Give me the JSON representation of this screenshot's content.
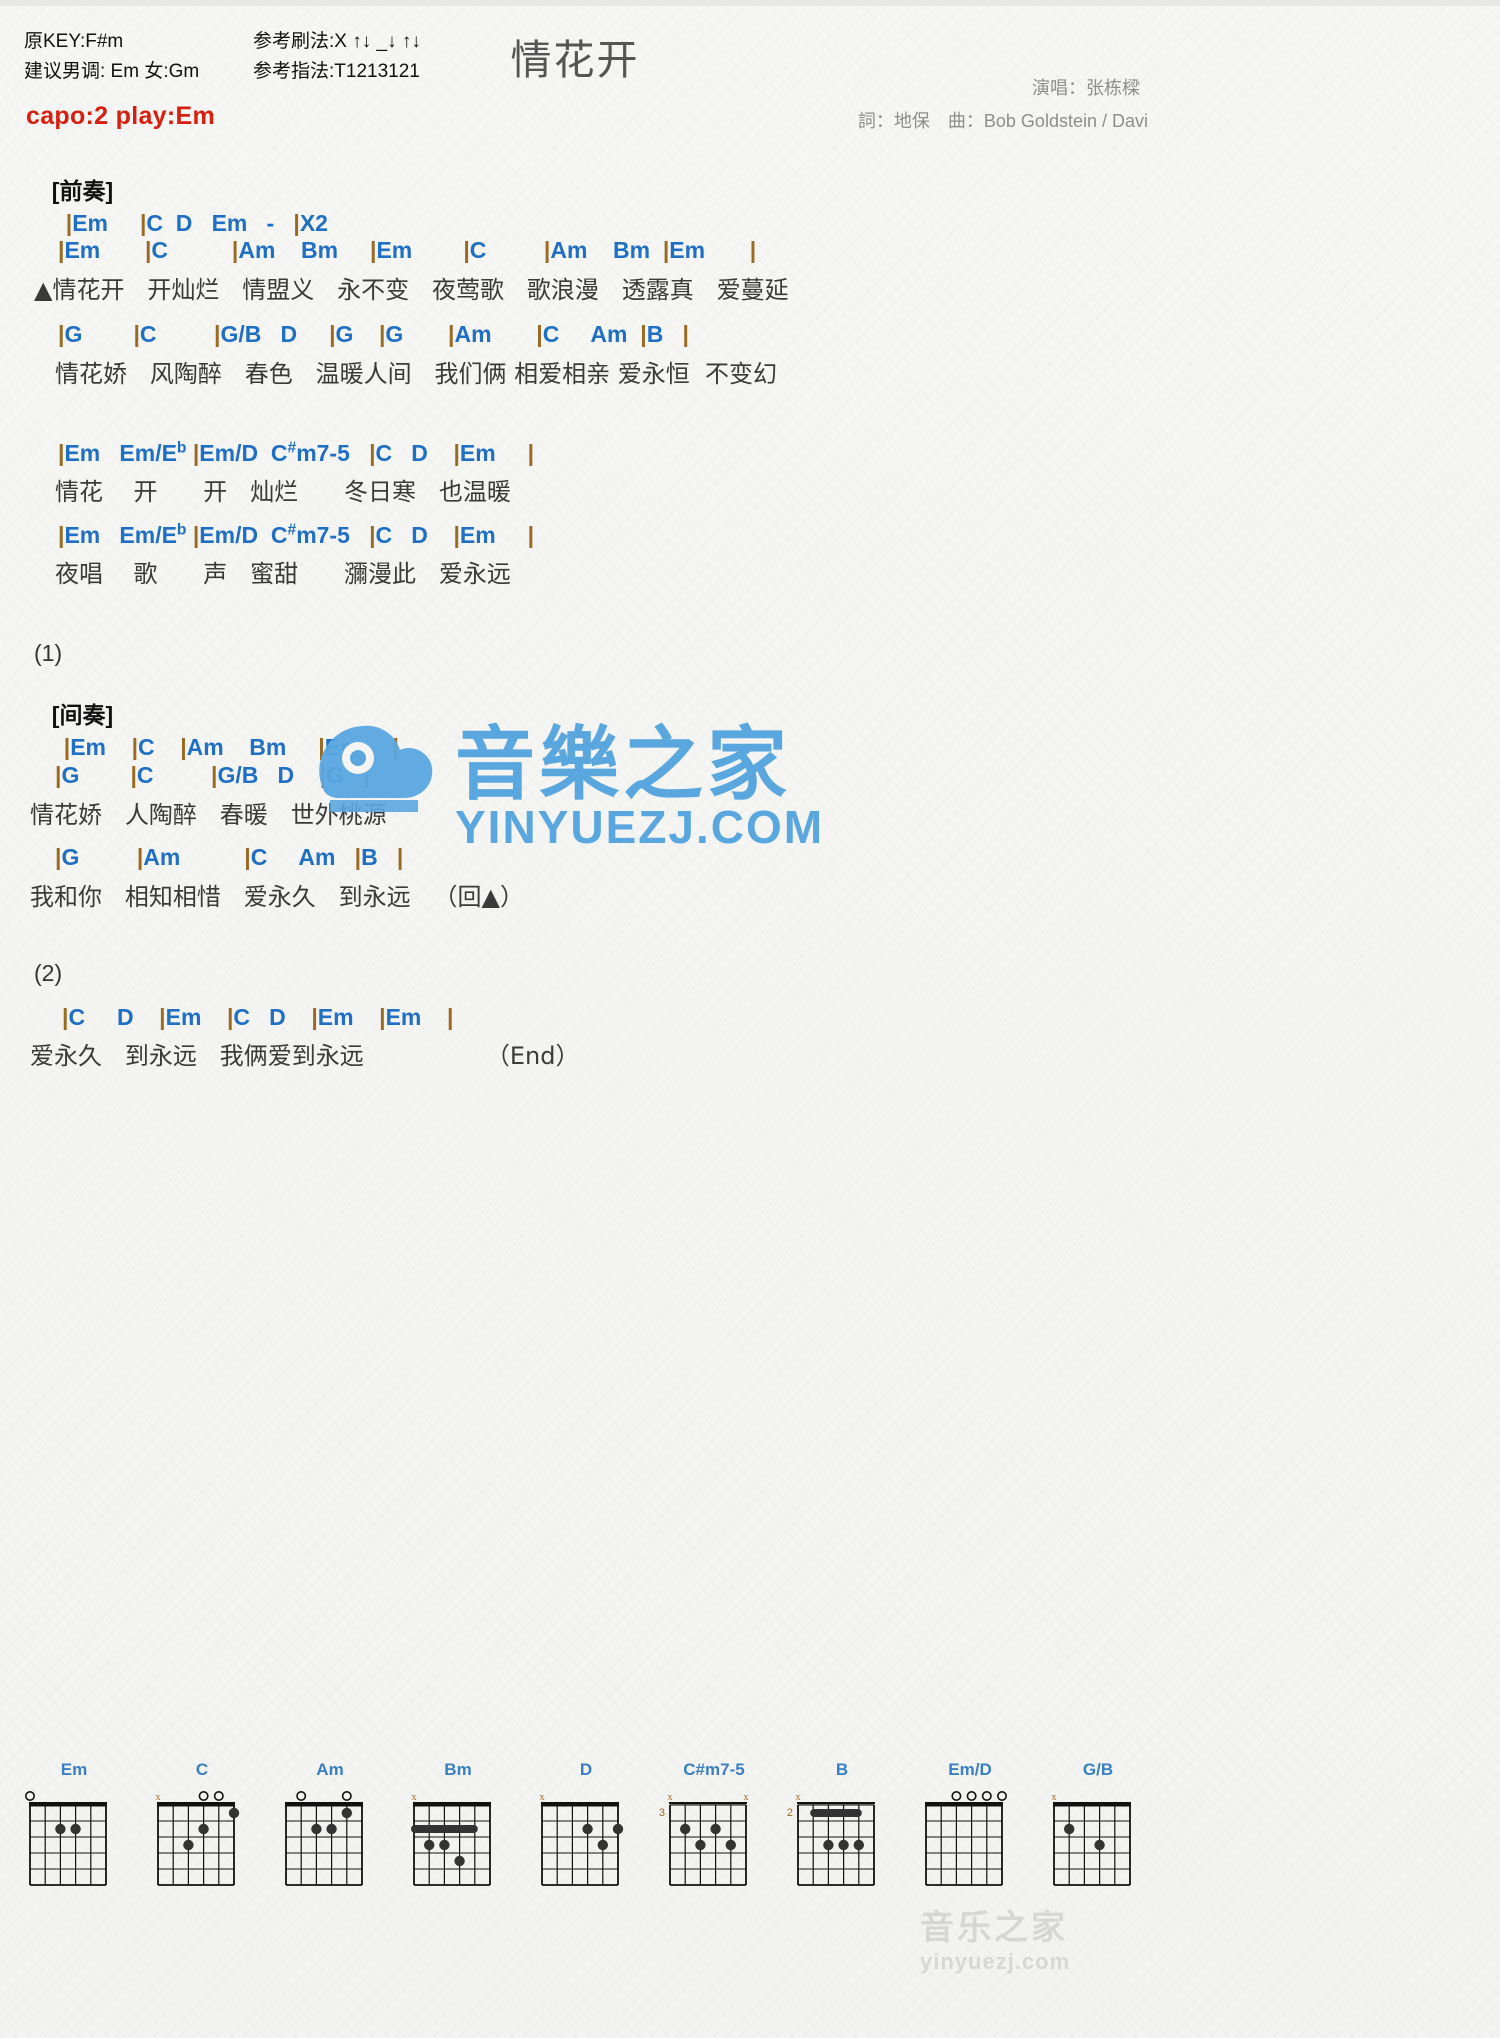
{
  "header": {
    "orig_key": "原KEY:F#m",
    "suggest_key": "建议男调: Em 女:Gm",
    "strum": "参考刷法:X ↑↓ _↓ ↑↓",
    "fingering": "参考指法:T1213121",
    "capo": "capo:2 play:Em",
    "title": "情花开",
    "singer": "演唱：张栋樑",
    "writers": "詞：地保　曲：Bob Goldstein / Davi",
    "accent_color": "#1f6fc4",
    "capo_color": "#d81f0f"
  },
  "intro": {
    "tag": "[前奏]",
    "chords": "|Em     |C  D   Em   -   |X2"
  },
  "verse1": {
    "line1_chords": "|Em       |C          |Am    Bm     |Em        |C         |Am    Bm  |Em       |",
    "line1_lyrics": "▲情花开   开灿烂   情盟义   永不变   夜莺歌   歌浪漫   透露真   爱蔓延",
    "line2_chords": "|G        |C         |G/B   D     |G    |G       |Am       |C     Am  |B   |",
    "line2_lyrics": "情花娇   风陶醉   春色   温暖人间   我们俩 相爱相亲 爱永恒  不变幻"
  },
  "verse2": {
    "line1_chords_parts": [
      "|Em",
      "Em/E",
      "b",
      "|Em/D",
      "C",
      "#",
      "m7-5",
      "|C    D",
      "|Em",
      "|"
    ],
    "line1_lyrics": "情花    开      开   灿烂      冬日寒   也温暖",
    "line2_lyrics": "夜唱    歌      声   蜜甜      瀰漫此   爱永远"
  },
  "section1": {
    "number": "(1)",
    "tag": "[间奏]",
    "chords": "|Em    |C    |Am    Bm     |Em     |",
    "line2_chords": "|G        |C         |G/B   D    |G   |",
    "line2_lyrics": "情花娇   人陶醉   春暖   世外桃源",
    "line3_chords": "|G         |Am          |C     Am   |B   |",
    "line3_lyrics": "我和你   相知相惜   爱永久   到永远   （回▲）"
  },
  "section2": {
    "number": "(2)",
    "chords": "|C     D    |Em    |C   D    |Em    |Em    |",
    "lyrics": "爱永久   到永远   我俩爱到永远                （End）"
  },
  "watermark": {
    "main": "音樂之家",
    "sub": "YINYUEZJ.COM",
    "bottom1": "音乐之家",
    "bottom2": "yinyuezj.com"
  },
  "diagrams": [
    {
      "name": "Em",
      "base": "",
      "open": [
        "o",
        "",
        "",
        "",
        "",
        ""
      ],
      "dots": [
        {
          "s": 2,
          "f": 2
        },
        {
          "s": 3,
          "f": 2
        }
      ],
      "barre": null
    },
    {
      "name": "C",
      "base": "",
      "open": [
        "x",
        "",
        "",
        "o",
        "o",
        ""
      ],
      "dots": [
        {
          "s": 2,
          "f": 3
        },
        {
          "s": 3,
          "f": 2
        },
        {
          "s": 5,
          "f": 1
        }
      ],
      "barre": null
    },
    {
      "name": "Am",
      "base": "",
      "open": [
        "",
        "o",
        "",
        "",
        "o",
        ""
      ],
      "dots": [
        {
          "s": 2,
          "f": 2
        },
        {
          "s": 3,
          "f": 2
        },
        {
          "s": 4,
          "f": 1
        }
      ],
      "barre": null
    },
    {
      "name": "Bm",
      "base": "",
      "open": [
        "x",
        "",
        "",
        "",
        "",
        ""
      ],
      "dots": [
        {
          "s": 3,
          "f": 4
        },
        {
          "s": 2,
          "f": 3
        },
        {
          "s": 1,
          "f": 3
        }
      ],
      "barre": {
        "f": 2,
        "from": 0,
        "to": 4
      }
    },
    {
      "name": "D",
      "base": "",
      "open": [
        "x",
        "",
        "",
        "",
        "",
        ""
      ],
      "dots": [
        {
          "s": 3,
          "f": 2
        },
        {
          "s": 5,
          "f": 2
        },
        {
          "s": 4,
          "f": 3
        }
      ],
      "barre": null
    },
    {
      "name": "C#m7-5",
      "base": "3",
      "open": [
        "x",
        "",
        "",
        "",
        "",
        "x"
      ],
      "dots": [
        {
          "s": 1,
          "f": 2
        },
        {
          "s": 3,
          "f": 2
        },
        {
          "s": 2,
          "f": 3
        },
        {
          "s": 4,
          "f": 3
        }
      ],
      "barre": null
    },
    {
      "name": "B",
      "base": "2",
      "open": [
        "x",
        "",
        "",
        "",
        "",
        ""
      ],
      "dots": [
        {
          "s": 2,
          "f": 3
        },
        {
          "s": 3,
          "f": 3
        },
        {
          "s": 4,
          "f": 3
        }
      ],
      "barre": {
        "f": 1,
        "from": 1,
        "to": 4
      }
    },
    {
      "name": "Em/D",
      "base": "",
      "open": [
        "",
        "",
        "o",
        "o",
        "o",
        "o"
      ],
      "dots": [],
      "barre": null
    },
    {
      "name": "G/B",
      "base": "",
      "open": [
        "x",
        "",
        "",
        "",
        "",
        ""
      ],
      "dots": [
        {
          "s": 1,
          "f": 2
        },
        {
          "s": 3,
          "f": 3
        }
      ],
      "barre": null
    }
  ]
}
